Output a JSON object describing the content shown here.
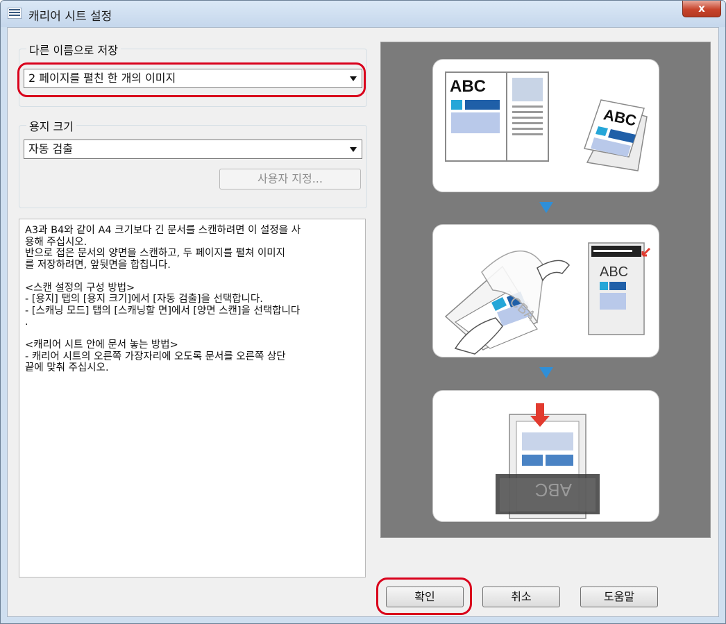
{
  "window": {
    "title": "캐리어 시트 설정",
    "close_label": "x"
  },
  "save_as": {
    "legend": "다른 이름으로 저장",
    "selected": "2 페이지를 펼친 한 개의 이미지"
  },
  "paper_size": {
    "legend": "용지 크기",
    "selected": "자동 검출",
    "custom_button": "사용자 지정..."
  },
  "description": {
    "lines": [
      "A3과 B4와 같이 A4 크기보다 긴 문서를 스캔하려면 이 설정을 사",
      "용해 주십시오.",
      "반으로 접은 문서의 양면을 스캔하고, 두 페이지를 펼쳐 이미지",
      "를 저장하려면, 앞뒷면을 합칩니다.",
      "",
      "<스캔 설정의 구성 방법>",
      "- [용지] 탭의 [용지 크기]에서 [자동 검출]을 선택합니다.",
      "- [스캐닝 모드] 탭의 [스캐닝할 면]에서 [양면 스캔]을 선택합니다",
      ".",
      "",
      "<캐리어 시트 안에 문서 놓는 방법>",
      "- 캐리어 시트의 오른쪽 가장자리에 오도록 문서를 오른쪽 상단",
      "끝에 맞춰 주십시오."
    ]
  },
  "preview": {
    "step1_text_a": "ABC",
    "step1_text_b": "ABC",
    "step2_text": "ABC",
    "step3_text": "ABC"
  },
  "buttons": {
    "ok": "확인",
    "cancel": "취소",
    "help": "도움말"
  },
  "colors": {
    "highlight": "#d9001b",
    "accent_blue": "#2f8fd8",
    "preview_bg": "#7b7b7b"
  },
  "icons": [
    "window-icon",
    "close-icon",
    "dropdown-arrow-icon",
    "down-arrow-icon",
    "insert-arrow-icon"
  ]
}
